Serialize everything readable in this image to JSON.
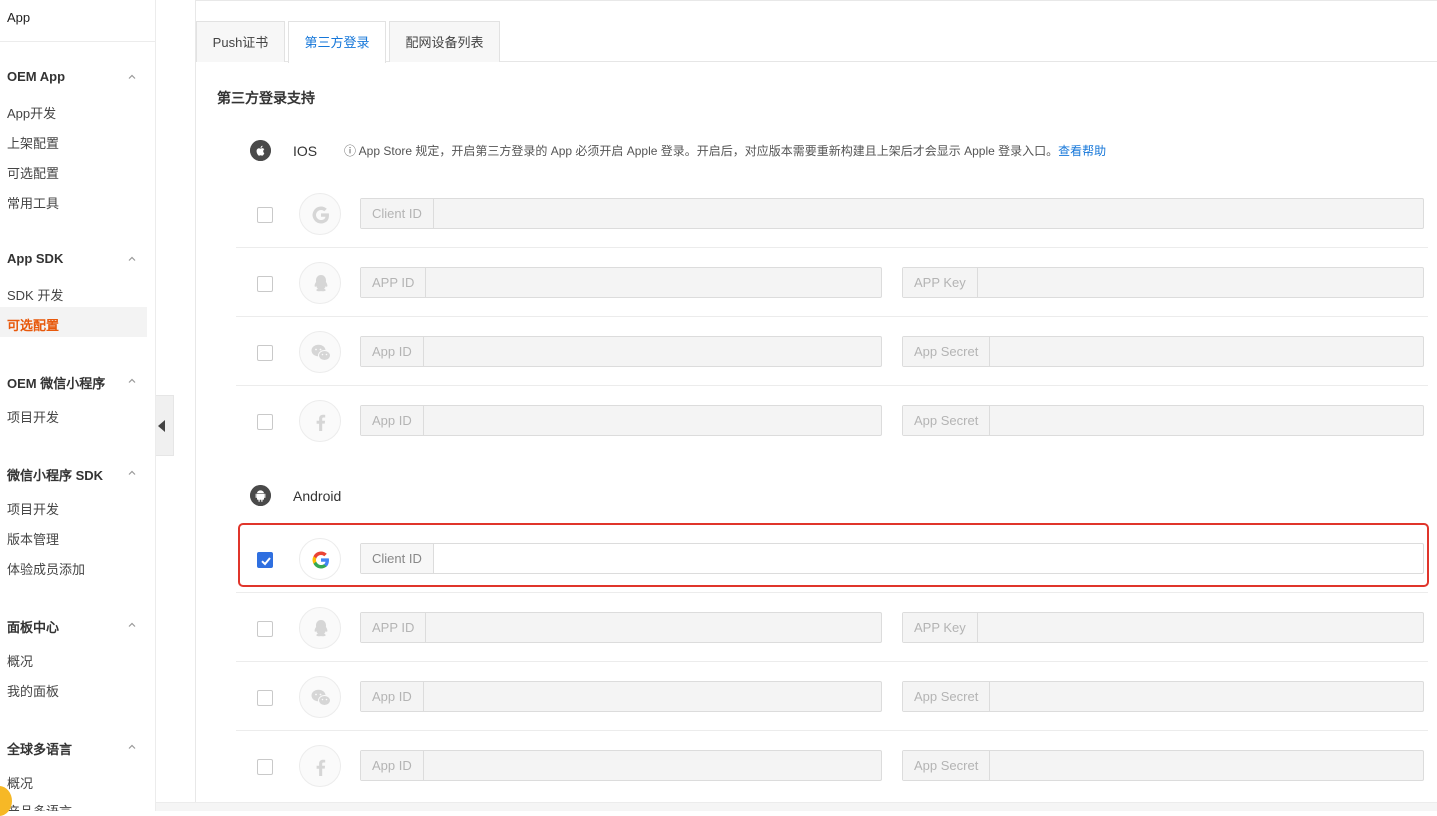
{
  "sidebar": {
    "app_title": "App",
    "groups": [
      {
        "title": "OEM App",
        "items": [
          "App开发",
          "上架配置",
          "可选配置",
          "常用工具"
        ]
      },
      {
        "title": "App SDK",
        "items": [
          "SDK 开发",
          "可选配置"
        ]
      },
      {
        "title": "OEM 微信小程序",
        "items": [
          "项目开发"
        ]
      },
      {
        "title": "微信小程序 SDK",
        "items": [
          "项目开发",
          "版本管理",
          "体验成员添加"
        ]
      },
      {
        "title": "面板中心",
        "items": [
          "概况",
          "我的面板"
        ]
      },
      {
        "title": "全球多语言",
        "items": [
          "概况",
          "产品多语言"
        ]
      }
    ]
  },
  "tabs": [
    "Push证书",
    "第三方登录",
    "配网设备列表"
  ],
  "active_tab": "第三方登录",
  "section_title": "第三方登录支持",
  "ios": {
    "label": "IOS",
    "notice": "ⓘ App Store 规定，开启第三方登录的 App 必须开启 Apple 登录。开启后，对应版本需要重新构建且上架后才会显示 Apple 登录入口。",
    "notice_link": "查看帮助",
    "rows": [
      {
        "logo": "google-icon",
        "checked": false,
        "fields": [
          "Client ID"
        ]
      },
      {
        "logo": "qq-icon",
        "checked": false,
        "fields": [
          "APP ID",
          "APP Key"
        ]
      },
      {
        "logo": "wechat-icon",
        "checked": false,
        "fields": [
          "App ID",
          "App Secret"
        ]
      },
      {
        "logo": "facebook-icon",
        "checked": false,
        "fields": [
          "App ID",
          "App Secret"
        ]
      }
    ]
  },
  "android": {
    "label": "Android",
    "rows": [
      {
        "logo": "google-icon",
        "checked": true,
        "fields": [
          "Client ID"
        ]
      },
      {
        "logo": "qq-icon",
        "checked": false,
        "fields": [
          "APP ID",
          "APP Key"
        ]
      },
      {
        "logo": "wechat-icon",
        "checked": false,
        "fields": [
          "App ID",
          "App Secret"
        ]
      },
      {
        "logo": "facebook-icon",
        "checked": false,
        "fields": [
          "App ID",
          "App Secret"
        ]
      }
    ]
  },
  "colors": {
    "accent": "#1677d9",
    "active_nav": "#e8590c",
    "highlight": "#e0352b",
    "checkbox": "#2f6fe0"
  }
}
